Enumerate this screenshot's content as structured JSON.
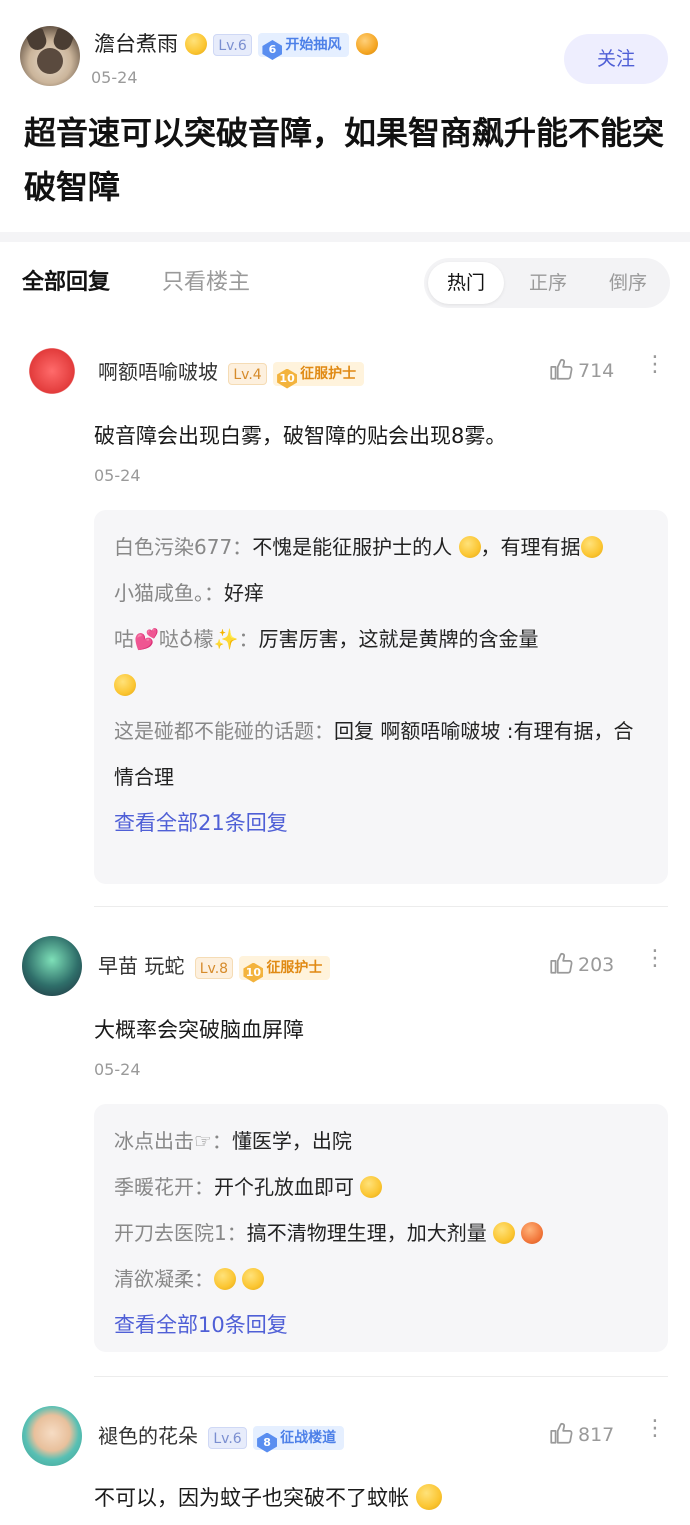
{
  "post": {
    "author": "澹台煮雨",
    "level": "Lv.6",
    "medal_num": "6",
    "medal_text": "开始抽风",
    "date": "05-24",
    "follow_label": "关注",
    "title": "超音速可以突破音障，如果智商飙升能不能突破智障"
  },
  "tabs": {
    "all": "全部回复",
    "op_only": "只看楼主",
    "sort": [
      "热门",
      "正序",
      "倒序"
    ]
  },
  "comments": [
    {
      "name": "啊额唔喻啵坡",
      "level": "Lv.4",
      "medal_num": "10",
      "medal_text": "征服护士",
      "likes": "714",
      "text": "破音障会出现白雾，破智障的贴会出现8雾。",
      "date": "05-24",
      "replies": [
        {
          "who": "白色污染677：",
          "text": "不愧是能征服护士的人",
          "text2": "，有理有据"
        },
        {
          "who": "小猫咸鱼。：",
          "text": "好痒"
        },
        {
          "who": "咕💕哒♁檬✨：",
          "text": "厉害厉害，这就是黄牌的含金量"
        },
        {
          "who": "这是碰都不能碰的话题：",
          "text": "回复 啊额唔喻啵坡 :有理有据，合情合理"
        }
      ],
      "view_all": "查看全部21条回复"
    },
    {
      "name": "早苗 玩蛇",
      "level": "Lv.8",
      "medal_num": "10",
      "medal_text": "征服护士",
      "likes": "203",
      "text": "大概率会突破脑血屏障",
      "date": "05-24",
      "replies": [
        {
          "who": "冰点出击☞：",
          "text": "懂医学，出院"
        },
        {
          "who": "季暖花开：",
          "text": "开个孔放血即可"
        },
        {
          "who": "开刀去医院1：",
          "text": "搞不清物理生理，加大剂量"
        },
        {
          "who": "清欲凝柔：",
          "text": ""
        }
      ],
      "view_all": "查看全部10条回复"
    },
    {
      "name": "褪色的花朵",
      "level": "Lv.6",
      "medal_num": "8",
      "medal_text": "征战楼道",
      "likes": "817",
      "text": "不可以，因为蚊子也突破不了蚊帐"
    }
  ],
  "colors": {
    "accent": "#4f5fd6",
    "follow_bg": "#eeeefe",
    "reply_bg": "#f6f6f8"
  }
}
